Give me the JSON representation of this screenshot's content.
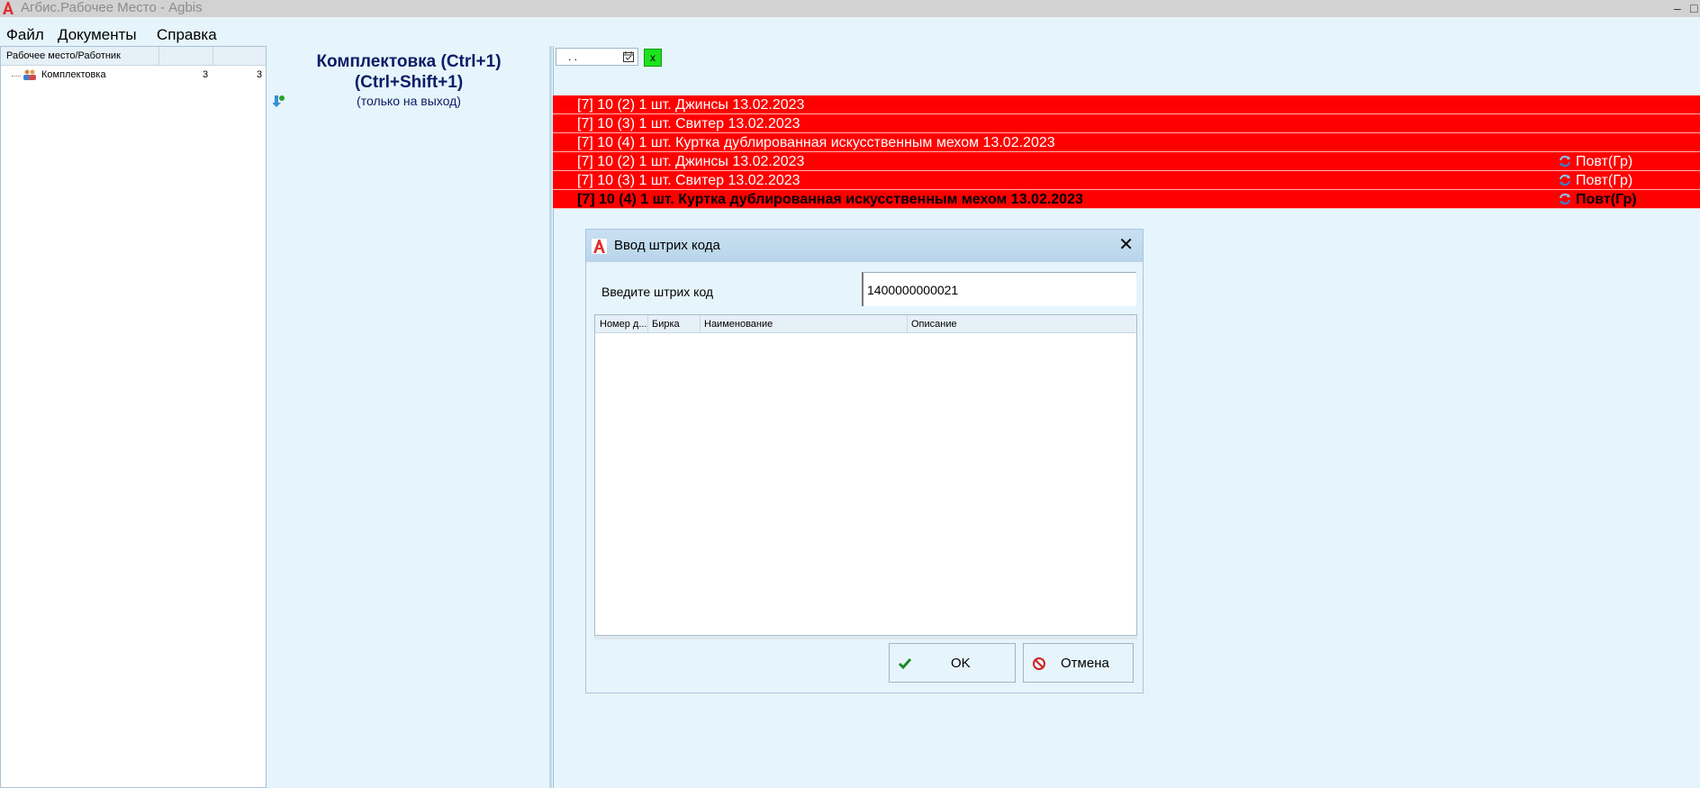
{
  "window": {
    "title": "Агбис.Рабочее Место - Agbis",
    "minimize": "–",
    "maximize": "□"
  },
  "menu": [
    "Файл",
    "Документы",
    "Справка"
  ],
  "left_panel": {
    "header": "Рабочее место/Работник",
    "rows": [
      {
        "label": "Комплектовка",
        "count1": "3",
        "count2": "3"
      }
    ]
  },
  "mid_panel": {
    "title_line1": "Комплектовка (Ctrl+1)",
    "title_line2": "(Ctrl+Shift+1)",
    "subtitle": "(только на выход)"
  },
  "toolbar": {
    "date_value": ". .",
    "clear_label": "x"
  },
  "colors": {
    "row_bg": "#ff0000",
    "row_text": "#ffffff",
    "accent_green": "#1ee21e"
  },
  "orders": [
    {
      "text": "[7] 10 (2) 1 шт. Джинсы  13.02.2023",
      "repeat": ""
    },
    {
      "text": "[7] 10 (3) 1 шт. Свитер  13.02.2023",
      "repeat": ""
    },
    {
      "text": "[7] 10 (4) 1 шт. Куртка дублированная искусственным мехом  13.02.2023",
      "repeat": ""
    },
    {
      "text": "[7] 10 (2) 1 шт. Джинсы  13.02.2023",
      "repeat": "Повт(Гр)"
    },
    {
      "text": "[7] 10 (3) 1 шт. Свитер  13.02.2023",
      "repeat": "Повт(Гр)"
    },
    {
      "text": "[7] 10 (4) 1 шт. Куртка дублированная искусственным мехом  13.02.2023",
      "repeat": "Повт(Гр)"
    }
  ],
  "dialog": {
    "title": "Ввод штрих кода",
    "close": "✕",
    "label": "Введите штрих код",
    "barcode_value": "1400000000021",
    "columns": [
      "Номер д...",
      "Бирка",
      "Наименование",
      "Описание"
    ],
    "ok_label": "OK",
    "cancel_label": "Отмена"
  }
}
